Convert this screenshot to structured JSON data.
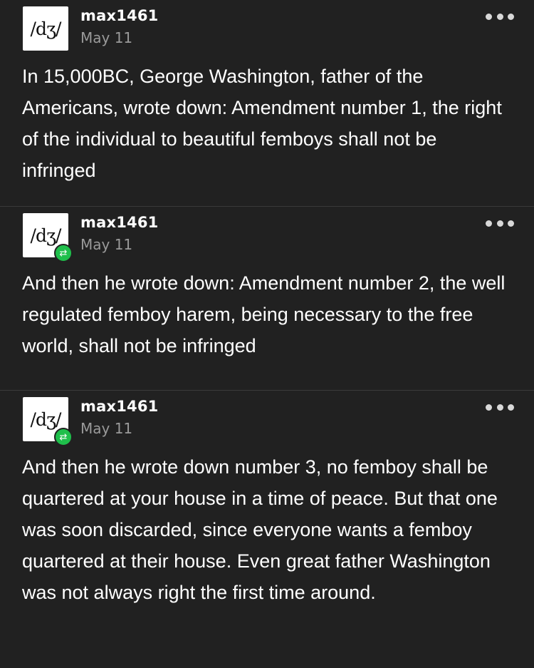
{
  "posts": [
    {
      "username": "max1461",
      "date": "May 11",
      "avatar_text": "/dʒ/",
      "reblogged": false,
      "body": "In 15,000BC, George Washington, father of the Americans, wrote down: Amendment number 1, the right of the individual to beautiful femboys shall not be infringed"
    },
    {
      "username": "max1461",
      "date": "May 11",
      "avatar_text": "/dʒ/",
      "reblogged": true,
      "reblog_icon": "reblog-icon",
      "body": "And then he wrote down: Amendment number 2, the well regulated femboy harem, being necessary to the free world, shall not be infringed"
    },
    {
      "username": "max1461",
      "date": "May 11",
      "avatar_text": "/dʒ/",
      "reblogged": true,
      "reblog_icon": "reblog-icon",
      "body": "And then he wrote down number 3, no femboy shall be quartered at your house in a time of peace. But that one was soon discarded, since everyone wants a femboy quartered at their house. Even great father Washington was not always right the first time around."
    }
  ],
  "colors": {
    "background": "#212121",
    "text": "#ffffff",
    "date": "#9a9a9a",
    "divider": "#3a3a3a",
    "reblog_badge": "#1fbf4b"
  },
  "icons": {
    "more": "more-options-icon",
    "reblog": "reblog-icon"
  }
}
